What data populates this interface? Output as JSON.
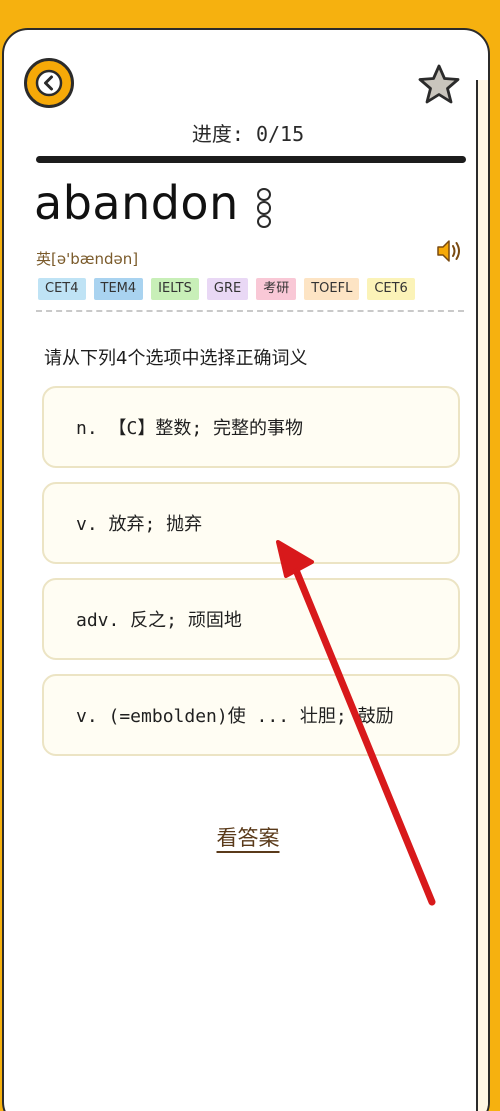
{
  "header": {
    "progress_text": "进度: 0/15",
    "progress_fraction": 0
  },
  "word": {
    "text": "abandon",
    "phonetic": "英[ə'bændən]"
  },
  "tags": [
    {
      "label": "CET4",
      "color": "#bfe3f5"
    },
    {
      "label": "TEM4",
      "color": "#a9d3f0"
    },
    {
      "label": "IELTS",
      "color": "#c8efb8"
    },
    {
      "label": "GRE",
      "color": "#e9d8f5"
    },
    {
      "label": "考研",
      "color": "#f9c8d6"
    },
    {
      "label": "TOEFL",
      "color": "#fde4c4"
    },
    {
      "label": "CET6",
      "color": "#fbf3b8"
    }
  ],
  "instruction": "请从下列4个选项中选择正确词义",
  "options": [
    {
      "label": "n. 【C】整数; 完整的事物"
    },
    {
      "label": "v. 放弃; 抛弃"
    },
    {
      "label": "adv. 反之; 顽固地"
    },
    {
      "label": "v. (=embolden)使 ... 壮胆; 鼓励"
    }
  ],
  "answer_link": "看答案",
  "colors": {
    "background": "#f6b10f",
    "accent": "#f6a908",
    "annotation_arrow": "#d8191b"
  },
  "icons": {
    "back": "chevron-left-icon",
    "favorite": "star-icon",
    "more": "more-vertical-icon",
    "speaker": "speaker-icon"
  }
}
